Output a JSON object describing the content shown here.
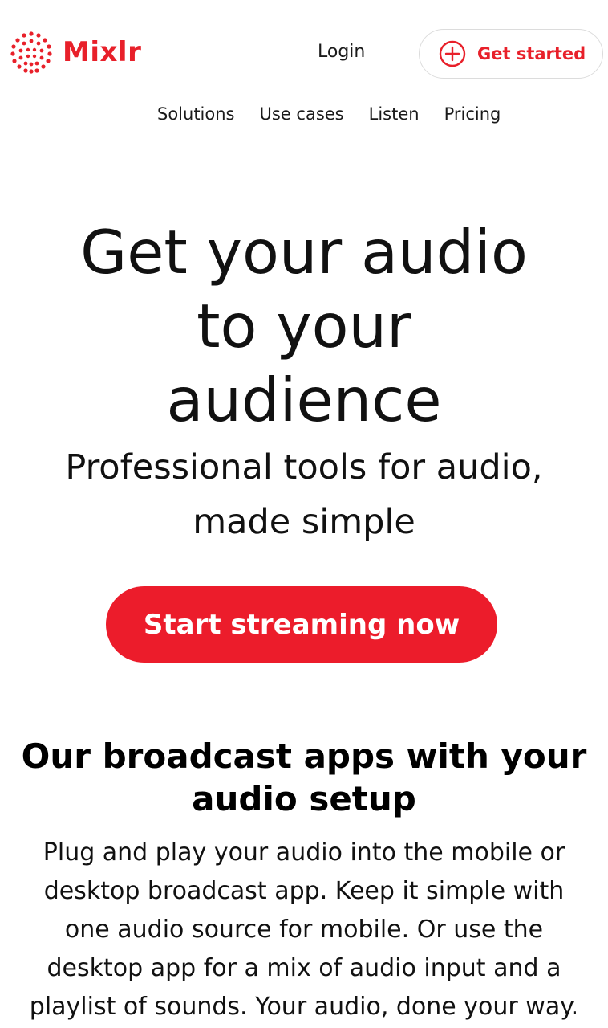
{
  "header": {
    "logo_text": "Mixlr",
    "login_label": "Login",
    "get_started_label": "Get started",
    "brand_color": "#e8202a"
  },
  "nav": {
    "items": [
      {
        "label": "Solutions"
      },
      {
        "label": "Use cases"
      },
      {
        "label": "Listen"
      },
      {
        "label": "Pricing"
      }
    ]
  },
  "hero": {
    "title_lines": [
      "Get your audio",
      "to your",
      "audience"
    ],
    "subtitle_lines": [
      "Professional tools for audio,",
      "made simple"
    ],
    "cta_label": "Start streaming now",
    "cta_color": "#ec1c2b"
  },
  "section": {
    "title_lines": [
      "Our broadcast apps with your",
      "audio setup"
    ],
    "body_lines": [
      "Plug and play your audio into the mobile or",
      "desktop broadcast app. Keep it simple with",
      "one audio source for mobile. Or use the",
      "desktop app for a mix of audio input and a",
      "playlist of sounds. Your audio, done your way."
    ]
  },
  "icons": {
    "logo": "mixlr-dot-logo-icon",
    "get_started": "plus-circle-icon"
  }
}
